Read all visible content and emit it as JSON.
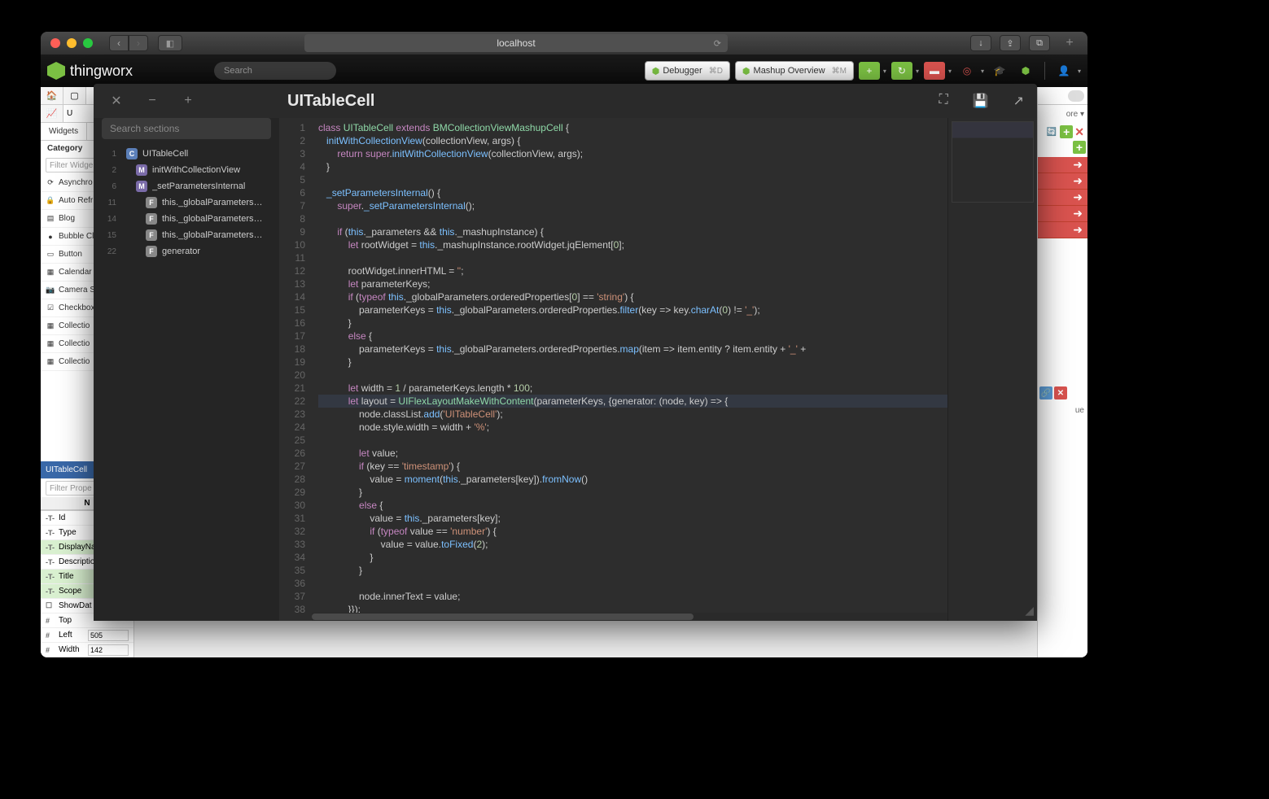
{
  "browser": {
    "url": "localhost",
    "tb_icons": [
      "↓",
      "⇪",
      "⧉"
    ]
  },
  "app": {
    "logo_text": "thingworx",
    "search_placeholder": "Search",
    "buttons": {
      "debugger": "Debugger",
      "debugger_kb": "⌘D",
      "mashup": "Mashup Overview",
      "mashup_kb": "⌘M"
    }
  },
  "sidebar": {
    "tabs": [
      "Widgets"
    ],
    "category_label": "Category",
    "filter_placeholder": "Filter Widge",
    "filter_props_placeholder": "Filter Prope",
    "items": [
      {
        "icon": "⟳",
        "label": "Asynchro"
      },
      {
        "icon": "🔒",
        "label": "Auto Refr"
      },
      {
        "icon": "▤",
        "label": "Blog"
      },
      {
        "icon": "●",
        "label": "Bubble Cl"
      },
      {
        "icon": "▭",
        "label": "Button"
      },
      {
        "icon": "▦",
        "label": "Calendar"
      },
      {
        "icon": "📷",
        "label": "Camera S"
      },
      {
        "icon": "☑",
        "label": "Checkbox"
      },
      {
        "icon": "▦",
        "label": "Collectio"
      },
      {
        "icon": "▦",
        "label": "Collectio"
      },
      {
        "icon": "▦",
        "label": "Collectio"
      }
    ],
    "selected": "UITableCell",
    "name_header": "N",
    "props": [
      {
        "t": "-T-",
        "label": "Id",
        "g": false
      },
      {
        "t": "-T-",
        "label": "Type",
        "g": false
      },
      {
        "t": "-T-",
        "label": "DisplayNa",
        "g": true
      },
      {
        "t": "-T-",
        "label": "Descriptio",
        "g": false
      },
      {
        "t": "-T-",
        "label": "Title",
        "g": true
      },
      {
        "t": "-T-",
        "label": "Scope",
        "g": true
      },
      {
        "t": "☐",
        "label": "ShowDat",
        "g": false
      },
      {
        "t": "#",
        "label": "Top",
        "g": false
      },
      {
        "t": "#",
        "label": "Left",
        "g": false,
        "val": "505"
      },
      {
        "t": "#",
        "label": "Width",
        "g": false,
        "val": "142"
      }
    ]
  },
  "right_panel": {
    "more_label": "ore ▾",
    "value_label": "ue",
    "arrows": 5
  },
  "editor": {
    "title": "UITableCell",
    "search_placeholder": "Search sections",
    "outline": [
      {
        "ln": 1,
        "kind": "c",
        "label": "UITableCell",
        "indent": 0
      },
      {
        "ln": 2,
        "kind": "m",
        "label": "initWithCollectionView",
        "indent": 1
      },
      {
        "ln": 6,
        "kind": "m",
        "label": "_setParametersInternal",
        "indent": 1
      },
      {
        "ln": 11,
        "kind": "f",
        "label": "this._globalParameters…",
        "indent": 2
      },
      {
        "ln": 14,
        "kind": "f",
        "label": "this._globalParameters…",
        "indent": 2
      },
      {
        "ln": 15,
        "kind": "f",
        "label": "this._globalParameters…",
        "indent": 2
      },
      {
        "ln": 22,
        "kind": "f",
        "label": "generator",
        "indent": 2
      }
    ],
    "code": [
      {
        "n": 1,
        "h": "<span class='tok-kw'>class</span> <span class='tok-cls'>UITableCell</span> <span class='tok-kw'>extends</span> <span class='tok-cls'>BMCollectionViewMashupCell</span> {"
      },
      {
        "n": 2,
        "h": "   <span class='tok-fn'>initWithCollectionView</span>(collectionView, args) {"
      },
      {
        "n": 3,
        "h": "       <span class='tok-kw'>return</span> <span class='tok-kw'>super</span>.<span class='tok-fn'>initWithCollectionView</span>(collectionView, args);"
      },
      {
        "n": 4,
        "h": "   }"
      },
      {
        "n": 5,
        "h": ""
      },
      {
        "n": 6,
        "h": "   <span class='tok-fn'>_setParametersInternal</span>() {"
      },
      {
        "n": 7,
        "h": "       <span class='tok-kw'>super</span>.<span class='tok-fn'>_setParametersInternal</span>();"
      },
      {
        "n": 8,
        "h": ""
      },
      {
        "n": 9,
        "h": "       <span class='tok-kw'>if</span> (<span class='tok-this'>this</span>._parameters && <span class='tok-this'>this</span>._mashupInstance) {"
      },
      {
        "n": 10,
        "h": "           <span class='tok-kw'>let</span> rootWidget = <span class='tok-this'>this</span>._mashupInstance.rootWidget.jqElement[<span class='tok-num'>0</span>];"
      },
      {
        "n": 11,
        "h": ""
      },
      {
        "n": 12,
        "h": "           rootWidget.innerHTML = <span class='tok-str'>''</span>;"
      },
      {
        "n": 13,
        "h": "           <span class='tok-kw'>let</span> parameterKeys;"
      },
      {
        "n": 14,
        "h": "           <span class='tok-kw'>if</span> (<span class='tok-kw'>typeof</span> <span class='tok-this'>this</span>._globalParameters.orderedProperties[<span class='tok-num'>0</span>] == <span class='tok-str'>'string'</span>) {"
      },
      {
        "n": 15,
        "h": "               parameterKeys = <span class='tok-this'>this</span>._globalParameters.orderedProperties.<span class='tok-fn'>filter</span>(key => key.<span class='tok-fn'>charAt</span>(<span class='tok-num'>0</span>) != <span class='tok-str'>'_'</span>);"
      },
      {
        "n": 16,
        "h": "           }"
      },
      {
        "n": 17,
        "h": "           <span class='tok-kw'>else</span> {"
      },
      {
        "n": 18,
        "h": "               parameterKeys = <span class='tok-this'>this</span>._globalParameters.orderedProperties.<span class='tok-fn'>map</span>(item => item.entity ? item.entity + <span class='tok-str'>'_'</span> +"
      },
      {
        "n": 19,
        "h": "           }"
      },
      {
        "n": 20,
        "h": ""
      },
      {
        "n": 21,
        "h": "           <span class='tok-kw'>let</span> width = <span class='tok-num'>1</span> / parameterKeys.length * <span class='tok-num'>100</span>;"
      },
      {
        "n": 22,
        "hl": true,
        "h": "           <span class='tok-kw'>let</span> layout = <span class='tok-cls'>UIFlexLayoutMakeWithContent</span>(parameterKeys, {generator: (node, key) => {"
      },
      {
        "n": 23,
        "h": "               node.classList.<span class='tok-fn'>add</span>(<span class='tok-str'>'UITableCell'</span>);"
      },
      {
        "n": 24,
        "h": "               node.style.width = width + <span class='tok-str'>'%'</span>;"
      },
      {
        "n": 25,
        "h": ""
      },
      {
        "n": 26,
        "h": "               <span class='tok-kw'>let</span> value;"
      },
      {
        "n": 27,
        "h": "               <span class='tok-kw'>if</span> (key == <span class='tok-str'>'timestamp'</span>) {"
      },
      {
        "n": 28,
        "h": "                   value = <span class='tok-fn'>moment</span>(<span class='tok-this'>this</span>._parameters[key]).<span class='tok-fn'>fromNow</span>()"
      },
      {
        "n": 29,
        "h": "               }"
      },
      {
        "n": 30,
        "h": "               <span class='tok-kw'>else</span> {"
      },
      {
        "n": 31,
        "h": "                   value = <span class='tok-this'>this</span>._parameters[key];"
      },
      {
        "n": 32,
        "h": "                   <span class='tok-kw'>if</span> (<span class='tok-kw'>typeof</span> value == <span class='tok-str'>'number'</span>) {"
      },
      {
        "n": 33,
        "h": "                       value = value.<span class='tok-fn'>toFixed</span>(<span class='tok-num'>2</span>);"
      },
      {
        "n": 34,
        "h": "                   }"
      },
      {
        "n": 35,
        "h": "               }"
      },
      {
        "n": 36,
        "h": ""
      },
      {
        "n": 37,
        "h": "               node.innerText = value;"
      },
      {
        "n": 38,
        "h": "           }});"
      }
    ]
  }
}
